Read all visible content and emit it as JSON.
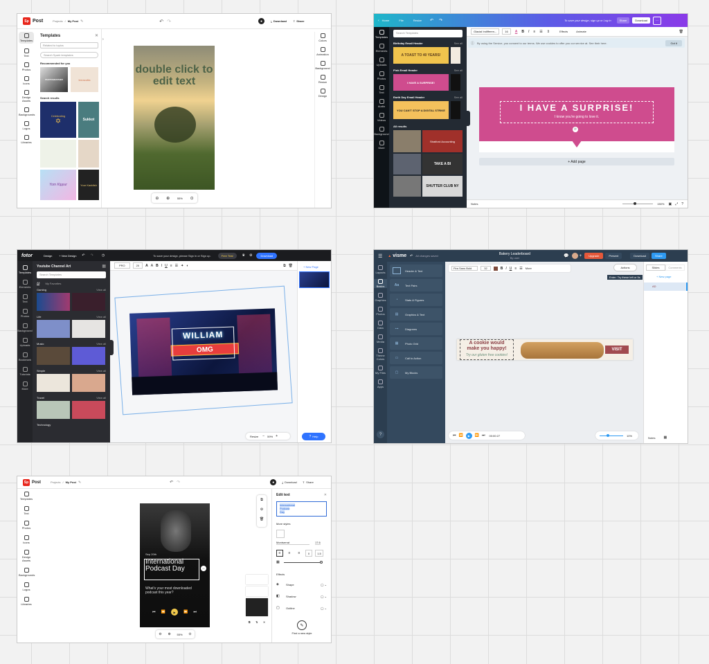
{
  "colors": {
    "adobe_red": "#e8261c",
    "canva_purple": "#7d2ae8",
    "canva_dark": "#18191b",
    "canva_pink": "#cf4c8e",
    "fotor_dark": "#232428",
    "fotor_blue": "#2f73ff",
    "visme_dark": "#2c3e50",
    "visme_orange": "#e5583a",
    "visme_blue": "#2e9af2"
  },
  "shot1": {
    "logo": "Sp",
    "app": "Post",
    "crumb_projects": "Projects",
    "crumb_file": "My Post",
    "download": "Download",
    "share": "Share",
    "rail": [
      "Templates",
      "Text",
      "Photos",
      "Icons",
      "Design Assets",
      "Backgrounds",
      "Logos",
      "Libraries"
    ],
    "panel_title": "Templates",
    "filter_placeholder": "Related to topics",
    "search_placeholder": "Search Spark templates",
    "recommended": "Recommended for you",
    "rec_thumb_text": [
      "PHOTOGRAPHER",
      "terracotta"
    ],
    "search_results": "Search results",
    "thumbs": [
      "Celebrating",
      "Sukkot",
      "Yom Kippur",
      "Your Kaddish"
    ],
    "canvas_text": "double click to edit text",
    "zoom": "55%",
    "right_rail": [
      "Colors",
      "Animation",
      "Background",
      "Resize",
      "Design"
    ]
  },
  "shot2": {
    "home": "Home",
    "file": "File",
    "resize": "Resize",
    "banner": "To save your design, sign up or Log in",
    "share": "Share",
    "download": "Download",
    "rail": [
      "Templates",
      "Elements",
      "Uploads",
      "Photos",
      "Text",
      "Audio",
      "Videos",
      "Background",
      "More"
    ],
    "search_placeholder": "Search Templates",
    "sec1": "Birthday Email Header",
    "sec1_thumb": "A TOAST TO 40 YEARS!",
    "sec2": "Pink Email Header",
    "sec2_thumb": "I HAVE A SURPRISE!",
    "sec3": "Earth Day Email Header",
    "sec3_thumb": "YOU CAN'T STOP A DIGITAL STRIKE",
    "see_all": "See all",
    "all_results": "All results",
    "res": [
      "Stratford Accounting",
      "TAKE A BI",
      "SHUTTER CLUB NY"
    ],
    "font": "Glacial Indifferen...",
    "font_size": "16",
    "effects": "Effects",
    "animate": "Animate",
    "cookie_notice": "By using the Service, you consent to our terms. We use cookies to offer you our service at. See their here.",
    "got_it": "Got it",
    "canvas_title": "I HAVE A SURPRISE!",
    "canvas_sub": "I know you're going to love it.",
    "add_page": "+ Add page",
    "notes": "Notes",
    "zoom": "150%"
  },
  "shot3": {
    "logo": "fotor",
    "design": "Design",
    "new_design": "+ New Design",
    "banner": "To save your design, please Sign in or Sign up.",
    "free_trial": "Free Trial",
    "download": "Download",
    "rail": [
      "Templates",
      "Elements",
      "Text",
      "Photos",
      "Background",
      "Uploads",
      "Bookmark",
      "Tutorials",
      "More"
    ],
    "panel_title": "Youtube Channel Art",
    "search_placeholder": "Search Templates",
    "tab_all": "All",
    "tab_fav": "My Favorites",
    "sections": [
      "Gaming",
      "Life",
      "Music",
      "Simple",
      "Travel",
      "Technology"
    ],
    "view_all": "View all",
    "font": "PRO",
    "font_size": "20",
    "canvas_line1": "WILLIAM",
    "canvas_line2": "OMG",
    "new_page": "+ New Page",
    "resize": "Resize",
    "zoom": "59%",
    "help": "Help"
  },
  "shot4": {
    "logo": "visme",
    "saved": "All changes saved",
    "doc_title": "Bakery Leaderboard",
    "doc_sub": "By user",
    "upgrade": "Upgrade",
    "present": "Present",
    "download": "Download",
    "share": "Share",
    "rail": [
      "Layouts",
      "Basics",
      "Graphics",
      "Photos",
      "Data",
      "Media",
      "Theme Colors",
      "My Files",
      "Apps"
    ],
    "blocks": [
      "Header & Text",
      "Text Pairs",
      "Stats & Figures",
      "Graphics & Text",
      "Diagrams",
      "Photo Grid",
      "Call to Action",
      "My Blocks"
    ],
    "font": "Fira Sans Bold",
    "font_size": "32",
    "more": "More",
    "actions": "Actions",
    "tooltip": "Enter: Try these left or 5s",
    "slides": "Slides",
    "comments": "Comments",
    "new_page": "+ New page",
    "ad_line1": "A cookie would",
    "ad_line2": "make you happy!",
    "ad_line3": "Try our gluten free cookies!",
    "visit": "VISIT",
    "time": "00:00:27",
    "zoom": "10%",
    "notes": "Notes",
    "thumb_label": "AD"
  },
  "shot5": {
    "logo": "Sp",
    "app": "Post",
    "crumb_projects": "Projects",
    "crumb_file": "My Post",
    "download": "Download",
    "share": "Share",
    "rail": [
      "Templates",
      "Text",
      "Photos",
      "Icons",
      "Design Assets",
      "Backgrounds",
      "Logos",
      "Libraries"
    ],
    "card_date": "Sep 20th",
    "card_title": "International Podcast Day",
    "card_sub": "What's your most downloaded podcast this year?",
    "zoom": "55%",
    "panel_title": "Edit text",
    "edit_lines": [
      "International",
      "Podcast",
      "Day"
    ],
    "more_styles": "More styles",
    "font": "Montserrat",
    "font_size": "17.6",
    "letter": "0",
    "line": "1.5",
    "effects": "Effects",
    "effect_list": [
      "Shape",
      "Shadow",
      "Outline"
    ],
    "find_style": "Find a new style"
  }
}
